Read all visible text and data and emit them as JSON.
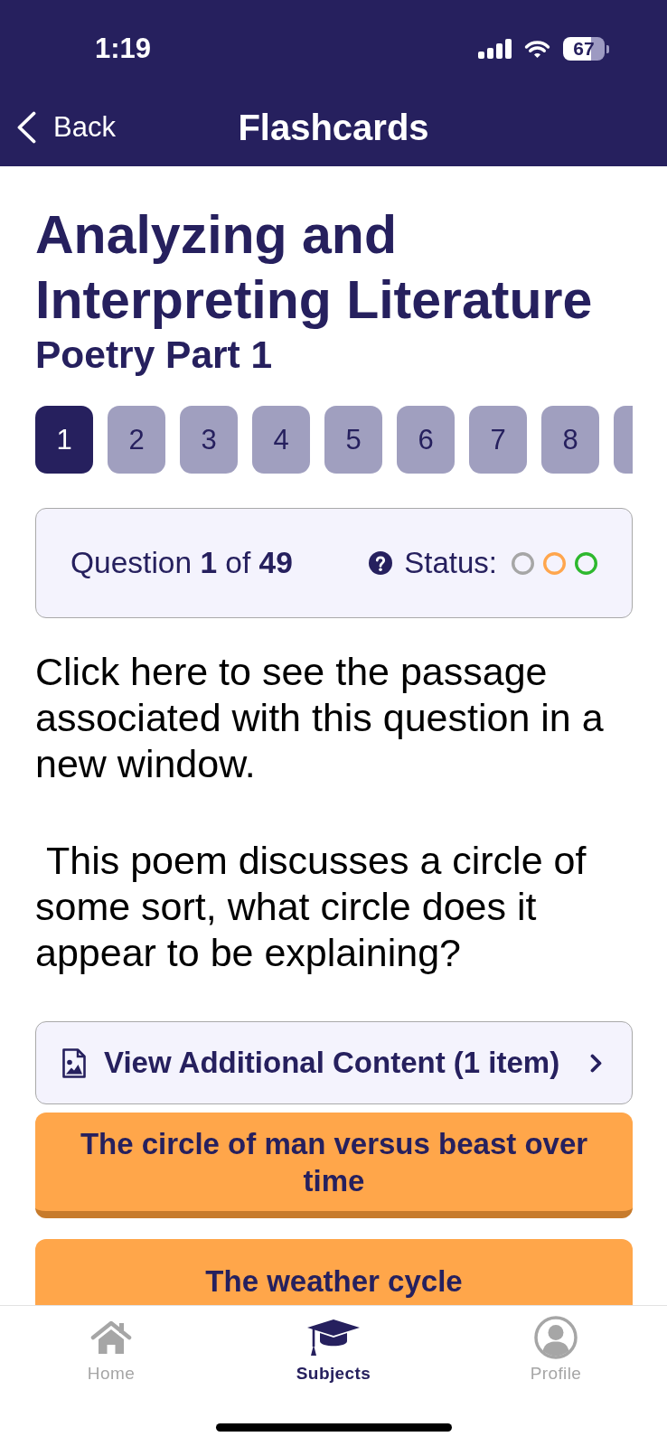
{
  "status_bar": {
    "time": "1:19",
    "battery": "67"
  },
  "nav_bar": {
    "back_label": "Back",
    "title": "Flashcards"
  },
  "deck": {
    "title": "Analyzing and Interpreting Literature",
    "subtitle": "Poetry Part 1"
  },
  "question_tabs": [
    {
      "label": "1",
      "selected": true
    },
    {
      "label": "2",
      "selected": false
    },
    {
      "label": "3",
      "selected": false
    },
    {
      "label": "4",
      "selected": false
    },
    {
      "label": "5",
      "selected": false
    },
    {
      "label": "6",
      "selected": false
    },
    {
      "label": "7",
      "selected": false
    },
    {
      "label": "8",
      "selected": false
    },
    {
      "selected": false
    }
  ],
  "question_info": {
    "counter_text": "Question **1** of **49**",
    "status_label": "Status:",
    "status_markers": [
      {
        "color": "#a6a6a6"
      },
      {
        "color": "#ffa64d"
      },
      {
        "color": "#2eb82e"
      }
    ]
  },
  "passage_link": "Click here to see the passage associated with this question in a new window.",
  "question": " This poem discusses a circle of some sort, what circle does it appear to be explaining?",
  "additional_content": {
    "label": "View Additional Content (1 item)"
  },
  "answers": [
    {
      "text": "The circle of man versus beast over time"
    },
    {
      "text": "The weather cycle"
    }
  ],
  "tab_bar": [
    {
      "label": "Home",
      "selected": false
    },
    {
      "label": "Subjects",
      "selected": true
    },
    {
      "label": "Profile",
      "selected": false
    }
  ]
}
